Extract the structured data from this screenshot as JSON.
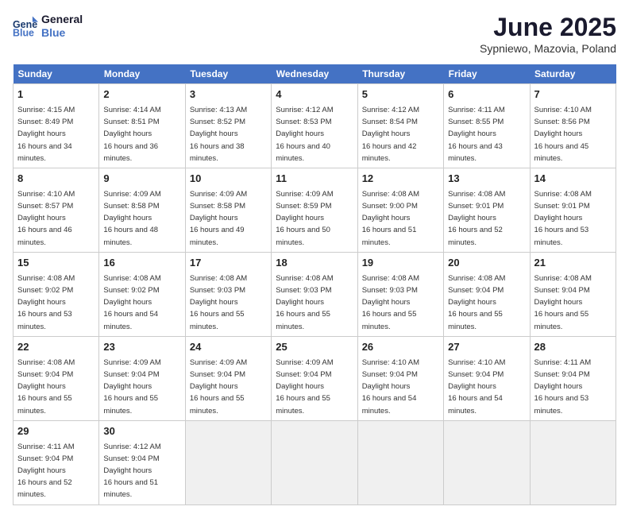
{
  "header": {
    "logo_line1": "General",
    "logo_line2": "Blue",
    "month": "June 2025",
    "location": "Sypniewo, Mazovia, Poland"
  },
  "weekdays": [
    "Sunday",
    "Monday",
    "Tuesday",
    "Wednesday",
    "Thursday",
    "Friday",
    "Saturday"
  ],
  "weeks": [
    [
      {
        "day": 1,
        "sunrise": "4:15 AM",
        "sunset": "8:49 PM",
        "daylight": "16 hours and 34 minutes."
      },
      {
        "day": 2,
        "sunrise": "4:14 AM",
        "sunset": "8:51 PM",
        "daylight": "16 hours and 36 minutes."
      },
      {
        "day": 3,
        "sunrise": "4:13 AM",
        "sunset": "8:52 PM",
        "daylight": "16 hours and 38 minutes."
      },
      {
        "day": 4,
        "sunrise": "4:12 AM",
        "sunset": "8:53 PM",
        "daylight": "16 hours and 40 minutes."
      },
      {
        "day": 5,
        "sunrise": "4:12 AM",
        "sunset": "8:54 PM",
        "daylight": "16 hours and 42 minutes."
      },
      {
        "day": 6,
        "sunrise": "4:11 AM",
        "sunset": "8:55 PM",
        "daylight": "16 hours and 43 minutes."
      },
      {
        "day": 7,
        "sunrise": "4:10 AM",
        "sunset": "8:56 PM",
        "daylight": "16 hours and 45 minutes."
      }
    ],
    [
      {
        "day": 8,
        "sunrise": "4:10 AM",
        "sunset": "8:57 PM",
        "daylight": "16 hours and 46 minutes."
      },
      {
        "day": 9,
        "sunrise": "4:09 AM",
        "sunset": "8:58 PM",
        "daylight": "16 hours and 48 minutes."
      },
      {
        "day": 10,
        "sunrise": "4:09 AM",
        "sunset": "8:58 PM",
        "daylight": "16 hours and 49 minutes."
      },
      {
        "day": 11,
        "sunrise": "4:09 AM",
        "sunset": "8:59 PM",
        "daylight": "16 hours and 50 minutes."
      },
      {
        "day": 12,
        "sunrise": "4:08 AM",
        "sunset": "9:00 PM",
        "daylight": "16 hours and 51 minutes."
      },
      {
        "day": 13,
        "sunrise": "4:08 AM",
        "sunset": "9:01 PM",
        "daylight": "16 hours and 52 minutes."
      },
      {
        "day": 14,
        "sunrise": "4:08 AM",
        "sunset": "9:01 PM",
        "daylight": "16 hours and 53 minutes."
      }
    ],
    [
      {
        "day": 15,
        "sunrise": "4:08 AM",
        "sunset": "9:02 PM",
        "daylight": "16 hours and 53 minutes."
      },
      {
        "day": 16,
        "sunrise": "4:08 AM",
        "sunset": "9:02 PM",
        "daylight": "16 hours and 54 minutes."
      },
      {
        "day": 17,
        "sunrise": "4:08 AM",
        "sunset": "9:03 PM",
        "daylight": "16 hours and 55 minutes."
      },
      {
        "day": 18,
        "sunrise": "4:08 AM",
        "sunset": "9:03 PM",
        "daylight": "16 hours and 55 minutes."
      },
      {
        "day": 19,
        "sunrise": "4:08 AM",
        "sunset": "9:03 PM",
        "daylight": "16 hours and 55 minutes."
      },
      {
        "day": 20,
        "sunrise": "4:08 AM",
        "sunset": "9:04 PM",
        "daylight": "16 hours and 55 minutes."
      },
      {
        "day": 21,
        "sunrise": "4:08 AM",
        "sunset": "9:04 PM",
        "daylight": "16 hours and 55 minutes."
      }
    ],
    [
      {
        "day": 22,
        "sunrise": "4:08 AM",
        "sunset": "9:04 PM",
        "daylight": "16 hours and 55 minutes."
      },
      {
        "day": 23,
        "sunrise": "4:09 AM",
        "sunset": "9:04 PM",
        "daylight": "16 hours and 55 minutes."
      },
      {
        "day": 24,
        "sunrise": "4:09 AM",
        "sunset": "9:04 PM",
        "daylight": "16 hours and 55 minutes."
      },
      {
        "day": 25,
        "sunrise": "4:09 AM",
        "sunset": "9:04 PM",
        "daylight": "16 hours and 55 minutes."
      },
      {
        "day": 26,
        "sunrise": "4:10 AM",
        "sunset": "9:04 PM",
        "daylight": "16 hours and 54 minutes."
      },
      {
        "day": 27,
        "sunrise": "4:10 AM",
        "sunset": "9:04 PM",
        "daylight": "16 hours and 54 minutes."
      },
      {
        "day": 28,
        "sunrise": "4:11 AM",
        "sunset": "9:04 PM",
        "daylight": "16 hours and 53 minutes."
      }
    ],
    [
      {
        "day": 29,
        "sunrise": "4:11 AM",
        "sunset": "9:04 PM",
        "daylight": "16 hours and 52 minutes."
      },
      {
        "day": 30,
        "sunrise": "4:12 AM",
        "sunset": "9:04 PM",
        "daylight": "16 hours and 51 minutes."
      },
      null,
      null,
      null,
      null,
      null
    ]
  ]
}
